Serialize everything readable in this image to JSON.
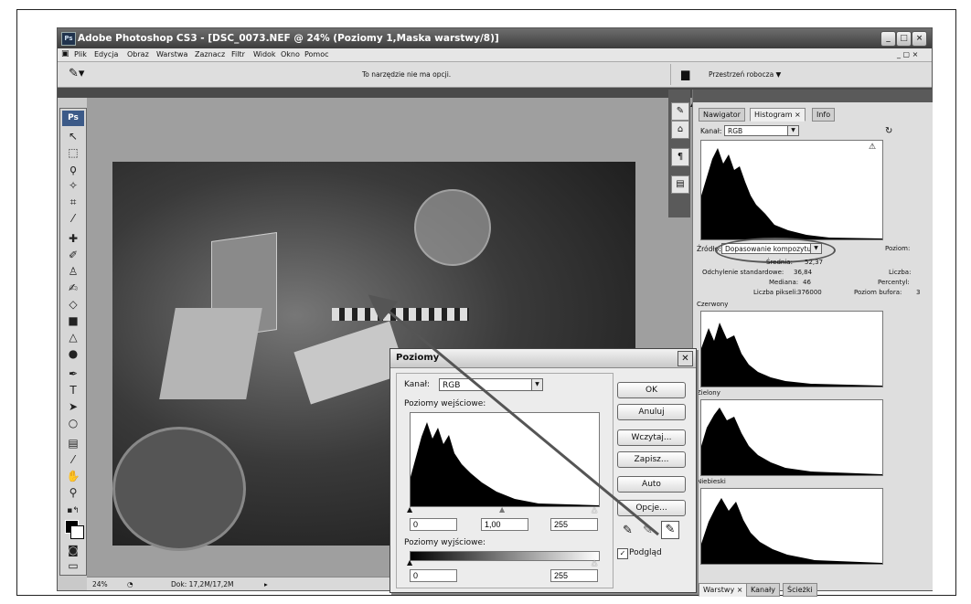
{
  "window": {
    "title": "Adobe Photoshop CS3 - [DSC_0073.NEF @ 24% (Poziomy 1,Maska warstwy/8)]",
    "app_icon": "photoshop-icon",
    "controls": {
      "min": "_",
      "max": "□",
      "close": "×"
    }
  },
  "menu": [
    "Plik",
    "Edycja",
    "Obraz",
    "Warstwa",
    "Zaznacz",
    "Filtr",
    "Widok",
    "Okno",
    "Pomoc"
  ],
  "options_bar": {
    "message": "To narzędzie nie ma opcji.",
    "workspace_label": "Przestrzeń robocza ▼"
  },
  "toolbox": {
    "badge": "Ps"
  },
  "status_bar": {
    "zoom": "24%",
    "doc": "Dok: 17,2M/17,2M"
  },
  "histogram_panel": {
    "tabs": [
      "Nawigator",
      "Histogram ×",
      "Info"
    ],
    "active_tab": 1,
    "channel_label": "Kanał:",
    "channel_value": "RGB",
    "source_label": "Źródło:",
    "source_value": "Dopasowanie kompozytu",
    "stats_left": [
      {
        "label": "Średnia:",
        "value": "52,37"
      },
      {
        "label": "Odchylenie standardowe:",
        "value": "36,84"
      },
      {
        "label": "Mediana:",
        "value": "46"
      },
      {
        "label": "Liczba pikseli:",
        "value": "376000"
      }
    ],
    "stats_right": [
      {
        "label": "Poziom:",
        "value": ""
      },
      {
        "label": "Liczba:",
        "value": ""
      },
      {
        "label": "Percentyl:",
        "value": ""
      },
      {
        "label": "Poziom bufora:",
        "value": "3"
      }
    ],
    "channels": [
      "Czerwony",
      "Zielony",
      "Niebieski"
    ],
    "warning_icon": "warning-icon"
  },
  "layers_panel": {
    "tabs": [
      "Warstwy ×",
      "Kanały",
      "Ścieżki"
    ]
  },
  "levels_dialog": {
    "title": "Poziomy",
    "channel_label": "Kanał:",
    "channel_value": "RGB",
    "input_label": "Poziomy wejściowe:",
    "input_values": {
      "black": "0",
      "gamma": "1,00",
      "white": "255"
    },
    "output_label": "Poziomy wyjściowe:",
    "output_values": {
      "black": "0",
      "white": "255"
    },
    "buttons": [
      "OK",
      "Anuluj",
      "Wczytaj...",
      "Zapisz...",
      "Auto",
      "Opcje..."
    ],
    "preview_label": "Podgląd",
    "preview_checked": true,
    "eyedroppers": [
      "black-eyedropper-icon",
      "gray-eyedropper-icon",
      "white-eyedropper-icon"
    ]
  }
}
